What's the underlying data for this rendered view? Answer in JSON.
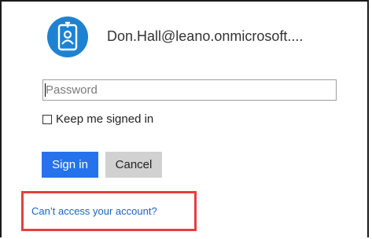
{
  "account": {
    "email": "Don.Hall@leano.onmicrosoft....",
    "avatar_icon": "id-badge-icon",
    "avatar_color": "#1e82d2"
  },
  "password": {
    "placeholder": "Password",
    "value": ""
  },
  "keep_signed_in": {
    "label": "Keep me signed in",
    "checked": false
  },
  "buttons": {
    "sign_in": "Sign in",
    "cancel": "Cancel"
  },
  "links": {
    "cant_access": "Can’t access your account?"
  },
  "colors": {
    "primary": "#2672ec",
    "secondary": "#d1d1d1",
    "link": "#1e62c4",
    "highlight": "#e53f3f"
  }
}
